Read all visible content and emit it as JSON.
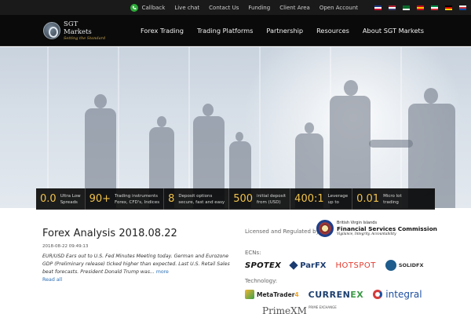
{
  "topbar": {
    "callback": "Callback",
    "live_chat": "Live chat",
    "contact_us": "Contact Us",
    "funding": "Funding",
    "client_area": "Client Area",
    "open_account": "Open Account",
    "flags": [
      {
        "name": "uk-flag-icon",
        "colors": [
          "#1f3a8a",
          "#ffffff",
          "#c8102e"
        ]
      },
      {
        "name": "us-flag-icon",
        "colors": [
          "#b22234",
          "#ffffff",
          "#3c3b6e"
        ]
      },
      {
        "name": "saudi-flag-icon",
        "colors": [
          "#0a6b2d",
          "#0a6b2d",
          "#ffffff"
        ]
      },
      {
        "name": "spain-flag-icon",
        "colors": [
          "#c60b1e",
          "#ffc400",
          "#c60b1e"
        ]
      },
      {
        "name": "italy-flag-icon",
        "colors": [
          "#009246",
          "#ffffff",
          "#ce2b37"
        ]
      },
      {
        "name": "germany-flag-icon",
        "colors": [
          "#000000",
          "#dd0000",
          "#ffce00"
        ]
      },
      {
        "name": "korea-flag-icon",
        "colors": [
          "#ffffff",
          "#cd2e3a",
          "#0047a0"
        ]
      }
    ]
  },
  "header": {
    "logo_name": "SGT Markets",
    "logo_tagline": "Setting the Standard",
    "nav": [
      "Forex Trading",
      "Trading Platforms",
      "Partnership",
      "Resources",
      "About SGT Markets"
    ]
  },
  "stats": [
    {
      "value": "0.0",
      "line1": "Ultra Low",
      "line2": "Spreads"
    },
    {
      "value": "90+",
      "line1": "Trading instruments",
      "line2": "Forex, CFD's, Indices"
    },
    {
      "value": "8",
      "line1": "Deposit options",
      "line2": "secure, fast and easy"
    },
    {
      "value": "500",
      "line1": "initial deposit",
      "line2": "from (USD)"
    },
    {
      "value": "400:1",
      "line1": "Leverage",
      "line2": "up to"
    },
    {
      "value": "0.01",
      "line1": "Micro lot",
      "line2": "trading"
    }
  ],
  "news": {
    "title": "Forex Analysis 2018.08.22",
    "date": "2018-08-22 09:49:13",
    "body": "EUR/USD Ears out to U.S. Fed Minutes Meeting today. German and Eurozone GDP (Preliminary release) ticked higher than expected. Last U.S. Retail Sales beat forecasts. President Donald Trump was...",
    "more": "more",
    "read_all": "Read all"
  },
  "regulation": {
    "label": "Licensed and Regulated by:",
    "line1": "British Virgin Islands",
    "line2": "Financial Services Commission",
    "line3": "Vigilance, Integrity, Accountability"
  },
  "ecns": {
    "label": "ECNs:",
    "spotex": "SPOTEX",
    "parfx": "ParFX",
    "hotspot": "HOTSPOT",
    "solidfx": "SOLIDFX"
  },
  "technology": {
    "label": "Technology:",
    "mt4_name": "MetaTrader",
    "mt4_num": "4",
    "currenex_a": "CURREN",
    "currenex_b": "EX",
    "integral": "integral",
    "primexm": "PrimeXM",
    "primexm_sub": "PRIME EXCHANGE"
  }
}
